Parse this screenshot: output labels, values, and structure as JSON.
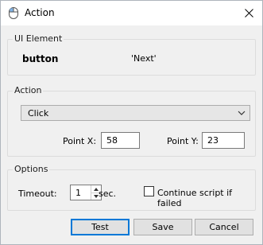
{
  "window": {
    "title": "Action",
    "close_glyph": "✕"
  },
  "ui_element": {
    "group_title": "UI Element",
    "type": "button",
    "name": "'Next'"
  },
  "action": {
    "group_title": "Action",
    "selected": "Click",
    "point_x_label": "Point X:",
    "point_x_value": "58",
    "point_y_label": "Point Y:",
    "point_y_value": "23"
  },
  "options": {
    "group_title": "Options",
    "timeout_label": "Timeout:",
    "timeout_value": "1",
    "timeout_unit": "sec.",
    "continue_label": "Continue script if failed",
    "continue_checked": false
  },
  "buttons": {
    "test": "Test",
    "save": "Save",
    "cancel": "Cancel"
  }
}
